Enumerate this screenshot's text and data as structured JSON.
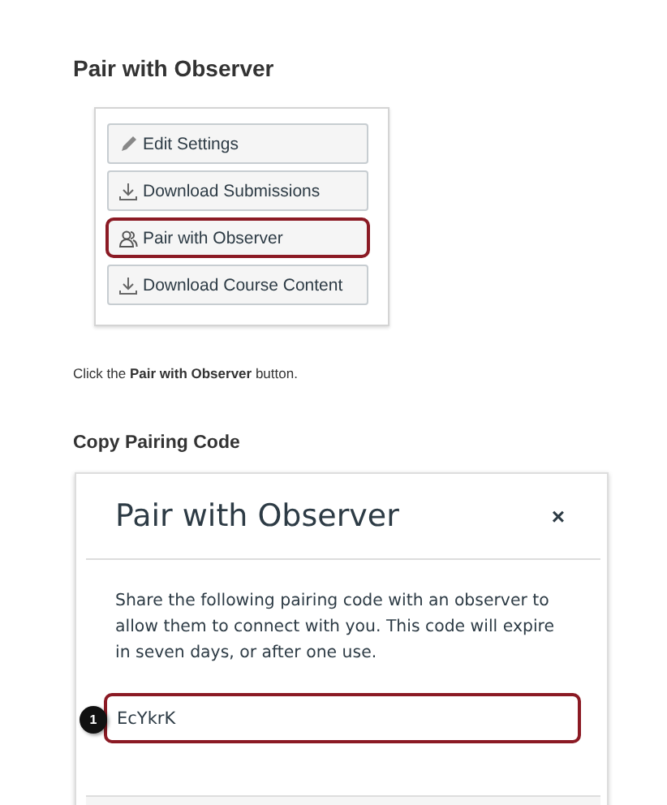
{
  "section_1": {
    "heading": "Pair with Observer",
    "buttons": [
      {
        "label": "Edit Settings",
        "kind": "edit",
        "highlighted": false
      },
      {
        "label": "Download Submissions",
        "kind": "download",
        "highlighted": false
      },
      {
        "label": "Pair with Observer",
        "kind": "pair",
        "highlighted": true
      },
      {
        "label": "Download Course Content",
        "kind": "download",
        "highlighted": false
      }
    ],
    "caption": "Click the **Pair with Observer** button."
  },
  "section_2": {
    "heading": "Copy Pairing Code",
    "dialog": {
      "title": "Pair with Observer",
      "close": "×",
      "message": "Share the following pairing code with an observer to allow them to connect with you. This code will expire in seven days, or after one use.",
      "code": "EcYkrK",
      "code_highlighted": true,
      "step_badge": "1"
    }
  }
}
